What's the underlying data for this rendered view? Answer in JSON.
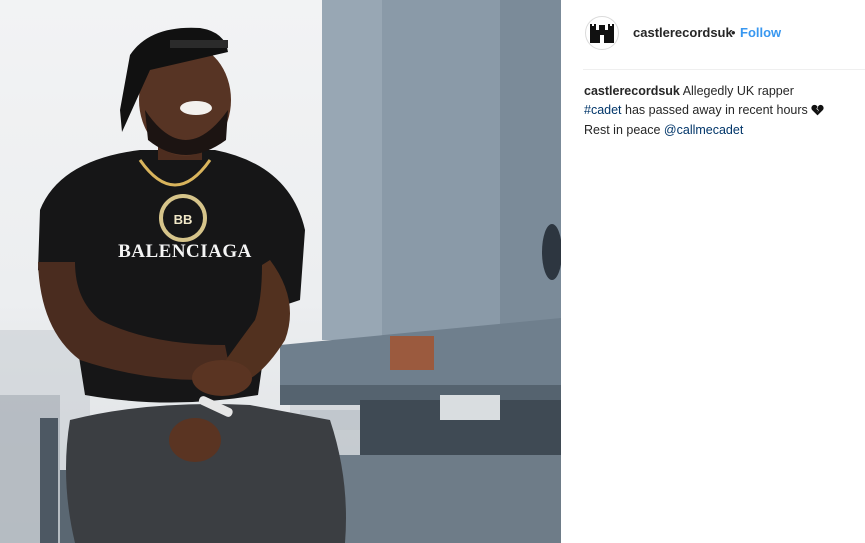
{
  "photo": {
    "shirt_text": "BALENCIAGA",
    "chain_text": "BB"
  },
  "post_header": {
    "username": "castlerecordsuk",
    "separator": "•",
    "follow_label": "Follow"
  },
  "caption": {
    "username": "castlerecordsuk",
    "text_1": "Allegedly UK rapper",
    "hashtag": "#cadet",
    "text_2": "has passed away in recent hours",
    "emoji": "broken-heart-icon",
    "text_3": "Rest in peace",
    "mention": "@callmecadet"
  }
}
